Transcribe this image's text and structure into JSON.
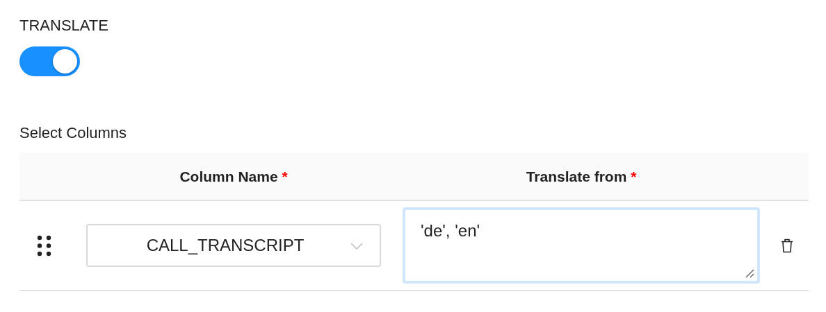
{
  "translate": {
    "label": "TRANSLATE",
    "on": true
  },
  "section_title": "Select Columns",
  "table": {
    "columns": [
      {
        "label": "Column Name",
        "required_mark": "*"
      },
      {
        "label": "Translate from",
        "required_mark": "*"
      }
    ],
    "rows": [
      {
        "column_name": "CALL_TRANSCRIPT",
        "translate_from": "'de', 'en'",
        "focused": true
      }
    ]
  }
}
